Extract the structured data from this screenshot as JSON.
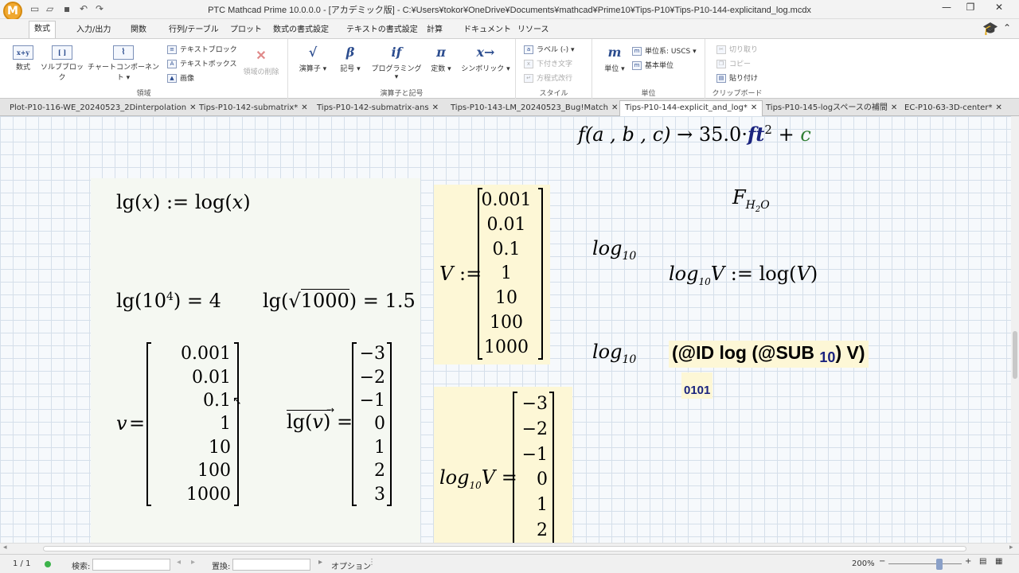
{
  "app": {
    "title": "PTC Mathcad Prime 10.0.0.0 - [アカデミック版] - C:¥Users¥tokor¥OneDrive¥Documents¥mathcad¥Prime10¥Tips-P10¥Tips-P10-144-explicitand_log.mcdx",
    "logo": "M"
  },
  "ribbon_tabs": [
    "数式",
    "入力/出力",
    "関数",
    "行列/テーブル",
    "プロット",
    "数式の書式設定",
    "テキストの書式設定",
    "計算",
    "ドキュメント",
    "リソース"
  ],
  "ribbon": {
    "regions": {
      "label": "領域",
      "math": "数式",
      "math_icon": "x+y",
      "solve_block": "ソルブブロック",
      "solve_icon": "[ ]",
      "chart": "チャートコンポーネント",
      "text_block": "テキストブロック",
      "text_box": "テキストボックス",
      "image": "画像",
      "delete_region": "領域の削除"
    },
    "operators": {
      "label": "演算子と記号",
      "operators": "演算子",
      "operators_icon": "√",
      "symbols": "記号",
      "symbols_icon": "β",
      "programming": "プログラミング",
      "programming_icon": "if",
      "constants": "定数",
      "constants_icon": "π",
      "symbolic": "シンボリック",
      "symbolic_icon": "x→"
    },
    "style": {
      "label": "スタイル",
      "label_dropdown": "ラベル (-)",
      "subscript": "下付き文字",
      "equation_line": "方程式改行"
    },
    "units": {
      "label": "単位",
      "units_btn": "単位",
      "units_icon": "m",
      "system": "単位系: USCS",
      "base_units": "基本単位"
    },
    "clipboard": {
      "label": "クリップボード",
      "cut": "切り取り",
      "copy": "コピー",
      "paste": "貼り付け"
    }
  },
  "doc_tabs": [
    {
      "label": "Plot-P10-116-WE_20240523_2Dinterpolation",
      "close": "✕"
    },
    {
      "label": "Tips-P10-142-submatrix*",
      "close": "✕"
    },
    {
      "label": "Tips-P10-142-submatrix-ans",
      "close": "✕"
    },
    {
      "label": "Tips-P10-143-LM_20240523_Bug!Match",
      "close": "✕"
    },
    {
      "label": "Tips-P10-144-explicit_and_log*",
      "close": "✕"
    },
    {
      "label": "Tips-P10-145-logスペースの補間",
      "close": "✕"
    },
    {
      "label": "EC-P10-63-3D-center*",
      "close": "✕"
    }
  ],
  "math": {
    "f_result": {
      "lhs": "f(a , b , c)",
      "arrow": "→",
      "coef": "35.0·",
      "unit": "ft",
      "exp": "2",
      "plus": "+",
      "c": "c"
    },
    "lg_def": {
      "lhs": "lg",
      "arg": "x",
      "assign": ":=",
      "rhs": "log",
      "rhs_arg": "x"
    },
    "lg_eval1": {
      "fn": "lg",
      "base": "10",
      "exp": "4",
      "eq": "=",
      "result": "4"
    },
    "lg_eval2": {
      "fn": "lg",
      "radicand": "1000",
      "eq": "=",
      "result": "1.5"
    },
    "v_def": {
      "name": "v",
      "eq": "=",
      "values": [
        "0.001",
        "0.01",
        "0.1",
        "1",
        "10",
        "100",
        "1000"
      ]
    },
    "lgv_eval": {
      "fn": "lg",
      "arg": "v",
      "eq": "=",
      "values": [
        "−3",
        "−2",
        "−1",
        "0",
        "1",
        "2",
        "3"
      ]
    },
    "V_def": {
      "name": "V",
      "assign": ":=",
      "values": [
        "0.001",
        "0.01",
        "0.1",
        "1",
        "10",
        "100",
        "1000"
      ]
    },
    "logV_eval": {
      "name": "log",
      "sub": "10",
      "var": "V",
      "eq": "=",
      "values": [
        "−3",
        "−2",
        "−1",
        "0",
        "1",
        "2"
      ]
    },
    "F_h2o": {
      "F": "F",
      "sub1": "H",
      "sub2": "2",
      "sub3": "O"
    },
    "log10_a": {
      "name": "log",
      "sub": "10"
    },
    "log10_b": {
      "name": "log",
      "sub": "10"
    },
    "log10V_def": {
      "name": "log",
      "sub": "10",
      "var": "V",
      "assign": ":=",
      "rhs": "log",
      "rhs_arg": "V"
    },
    "id_expr": {
      "prefix": "(@ID log (@SUB",
      "sub": "10",
      "suffix": ") V)"
    },
    "binary": "0101"
  },
  "status": {
    "page": "1 / 1",
    "search_label": "検索:",
    "replace_label": "置換:",
    "options": "オプション",
    "zoom": "200%"
  }
}
